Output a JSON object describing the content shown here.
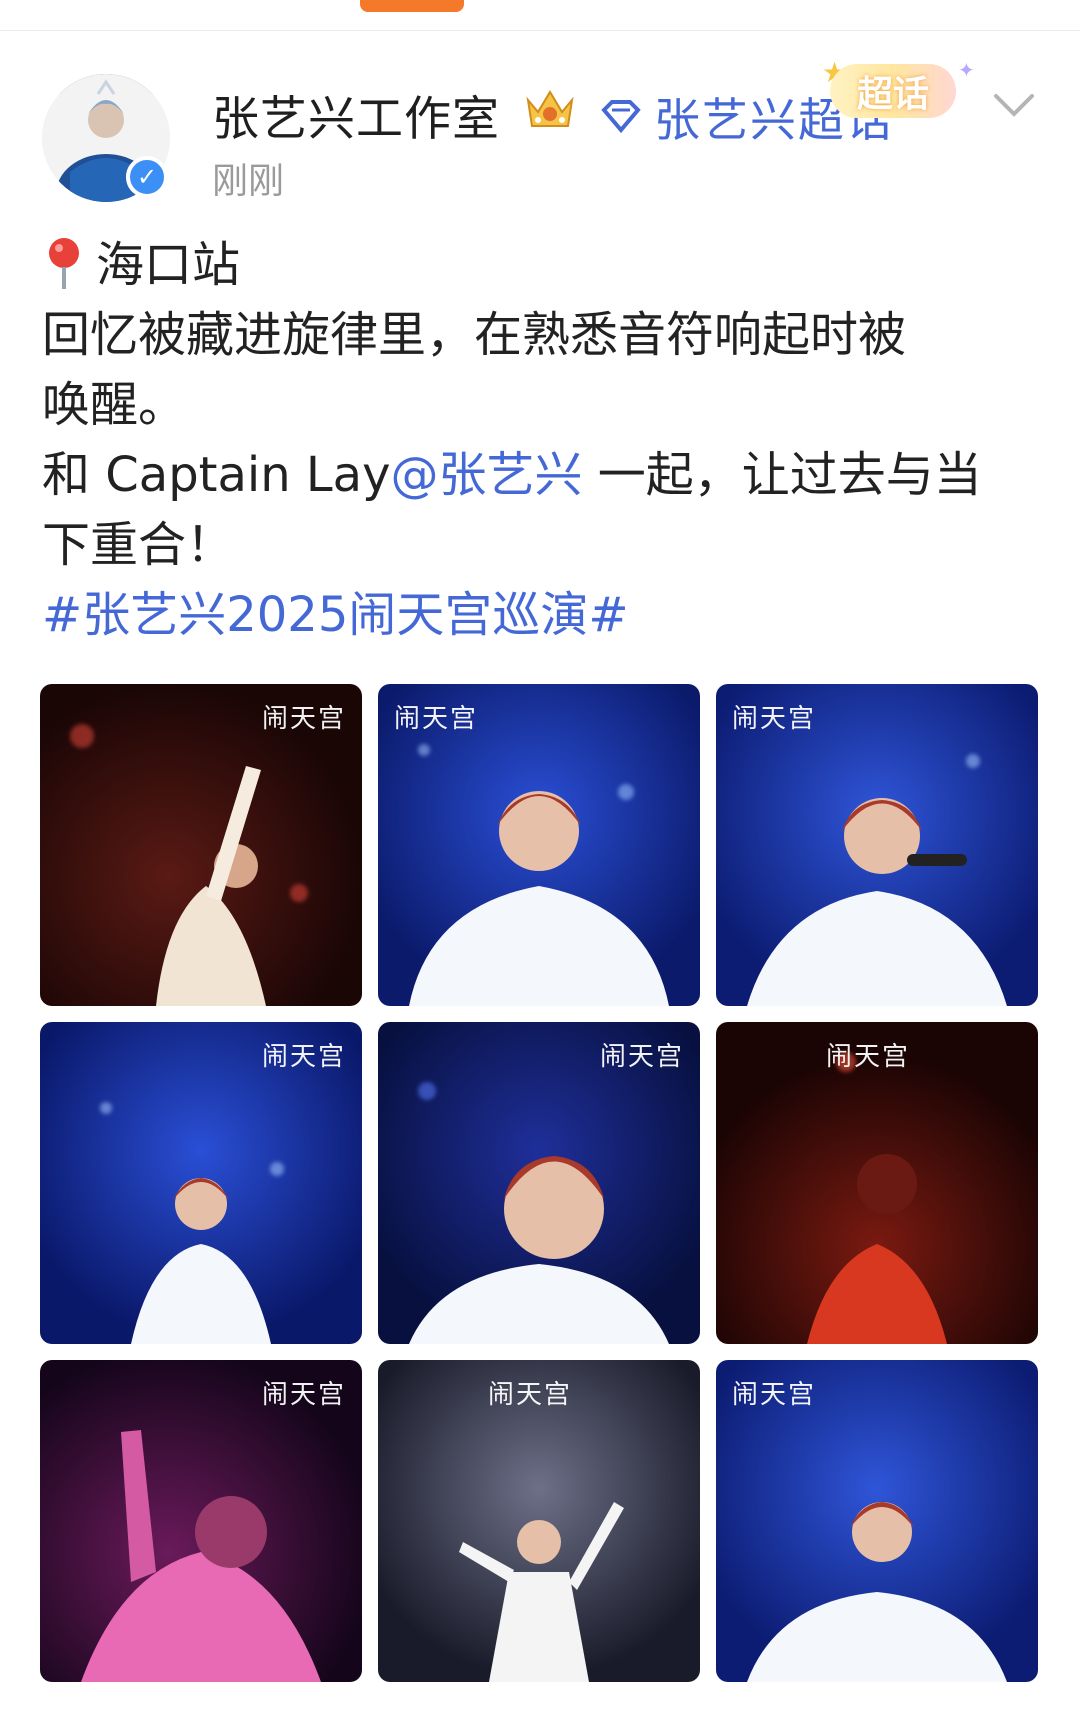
{
  "post": {
    "author_name": "张艺兴工作室",
    "supertopic_label": "张艺兴超话",
    "supertopic_badge": "超话",
    "timestamp": "刚刚",
    "location": "海口站",
    "line1": "回忆被藏进旋律里，在熟悉音符响起时被",
    "line2": "唤醒。",
    "line3_prefix": "和 Captain Lay",
    "mention": "@张艺兴",
    "line3_suffix": " 一起，让过去与当",
    "line4": "下重合！",
    "hashtag": "#张艺兴2025闹天宫巡演#"
  },
  "colors": {
    "accent_blue": "#4468d6",
    "top_indicator": "#f47a2a",
    "verified": "#3b8ff5"
  },
  "photos": [
    {
      "logo": "闹天宫",
      "palette": "dark-red"
    },
    {
      "logo": "闹天宫",
      "palette": "blue"
    },
    {
      "logo": "闹天宫",
      "palette": "blue"
    },
    {
      "logo": "闹天宫",
      "palette": "blue"
    },
    {
      "logo": "闹天宫",
      "palette": "dark-blue"
    },
    {
      "logo": "闹天宫",
      "palette": "red"
    },
    {
      "logo": "闹天宫",
      "palette": "magenta"
    },
    {
      "logo": "闹天宫",
      "palette": "grey"
    },
    {
      "logo": "闹天宫",
      "palette": "blue"
    }
  ],
  "icons": [
    "avatar",
    "verified-icon",
    "crown-icon",
    "diamond-icon",
    "chevron-down-icon",
    "location-pin-icon"
  ]
}
